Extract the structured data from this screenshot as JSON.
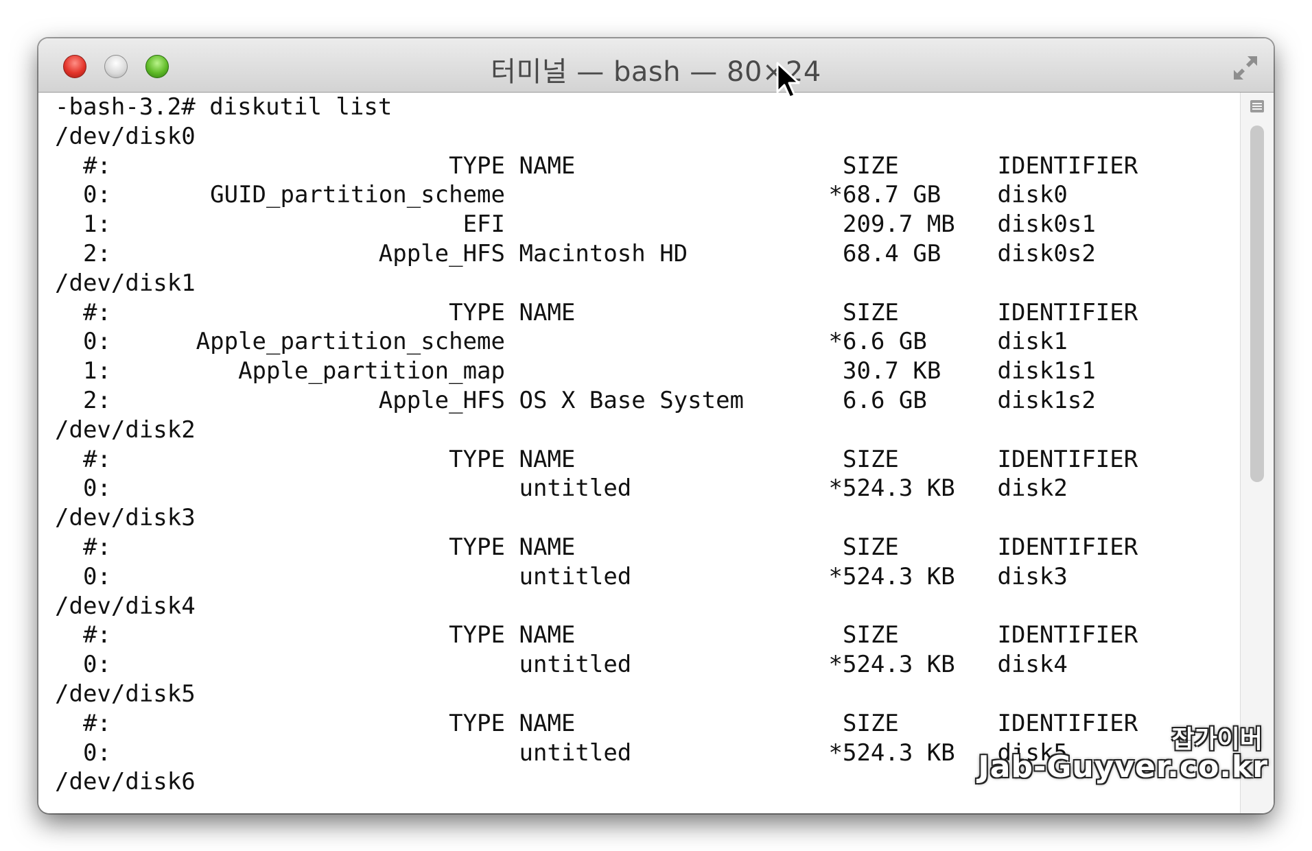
{
  "window": {
    "title": "터미널 — bash — 80×24"
  },
  "colors": {
    "close": "#e3342a",
    "minimize": "#c8c8c8",
    "zoom": "#5fba27",
    "text": "#111111",
    "background": "#ffffff"
  },
  "icons": {
    "close": "close-icon",
    "minimize": "minimize-icon",
    "zoom": "zoom-icon",
    "fullscreen": "fullscreen-icon",
    "split": "split-pane-icon",
    "cursor": "mouse-pointer-icon"
  },
  "terminal": {
    "prompt": "-bash-3.2#",
    "command": "diskutil list",
    "disks": [
      {
        "device": "/dev/disk0",
        "header": {
          "num": "#:",
          "type": "TYPE",
          "name": "NAME",
          "size": "SIZE",
          "identifier": "IDENTIFIER"
        },
        "partitions": [
          {
            "num": "0:",
            "type": "GUID_partition_scheme",
            "name": "",
            "size": "*68.7 GB",
            "identifier": "disk0"
          },
          {
            "num": "1:",
            "type": "EFI",
            "name": "",
            "size": "209.7 MB",
            "identifier": "disk0s1"
          },
          {
            "num": "2:",
            "type": "Apple_HFS",
            "name": "Macintosh HD",
            "size": "68.4 GB",
            "identifier": "disk0s2"
          }
        ]
      },
      {
        "device": "/dev/disk1",
        "header": {
          "num": "#:",
          "type": "TYPE",
          "name": "NAME",
          "size": "SIZE",
          "identifier": "IDENTIFIER"
        },
        "partitions": [
          {
            "num": "0:",
            "type": "Apple_partition_scheme",
            "name": "",
            "size": "*6.6 GB",
            "identifier": "disk1"
          },
          {
            "num": "1:",
            "type": "Apple_partition_map",
            "name": "",
            "size": "30.7 KB",
            "identifier": "disk1s1"
          },
          {
            "num": "2:",
            "type": "Apple_HFS",
            "name": "OS X Base System",
            "size": "6.6 GB",
            "identifier": "disk1s2"
          }
        ]
      },
      {
        "device": "/dev/disk2",
        "header": {
          "num": "#:",
          "type": "TYPE",
          "name": "NAME",
          "size": "SIZE",
          "identifier": "IDENTIFIER"
        },
        "partitions": [
          {
            "num": "0:",
            "type": "",
            "name": "untitled",
            "size": "*524.3 KB",
            "identifier": "disk2"
          }
        ]
      },
      {
        "device": "/dev/disk3",
        "header": {
          "num": "#:",
          "type": "TYPE",
          "name": "NAME",
          "size": "SIZE",
          "identifier": "IDENTIFIER"
        },
        "partitions": [
          {
            "num": "0:",
            "type": "",
            "name": "untitled",
            "size": "*524.3 KB",
            "identifier": "disk3"
          }
        ]
      },
      {
        "device": "/dev/disk4",
        "header": {
          "num": "#:",
          "type": "TYPE",
          "name": "NAME",
          "size": "SIZE",
          "identifier": "IDENTIFIER"
        },
        "partitions": [
          {
            "num": "0:",
            "type": "",
            "name": "untitled",
            "size": "*524.3 KB",
            "identifier": "disk4"
          }
        ]
      },
      {
        "device": "/dev/disk5",
        "header": {
          "num": "#:",
          "type": "TYPE",
          "name": "NAME",
          "size": "SIZE",
          "identifier": "IDENTIFIER"
        },
        "partitions": [
          {
            "num": "0:",
            "type": "",
            "name": "untitled",
            "size": "*524.3 KB",
            "identifier": "disk5"
          }
        ]
      },
      {
        "device": "/dev/disk6",
        "header": null,
        "partitions": []
      }
    ]
  },
  "watermark": {
    "line1": "잡가이버",
    "line2": "Jab-Guyver.co.kr"
  }
}
